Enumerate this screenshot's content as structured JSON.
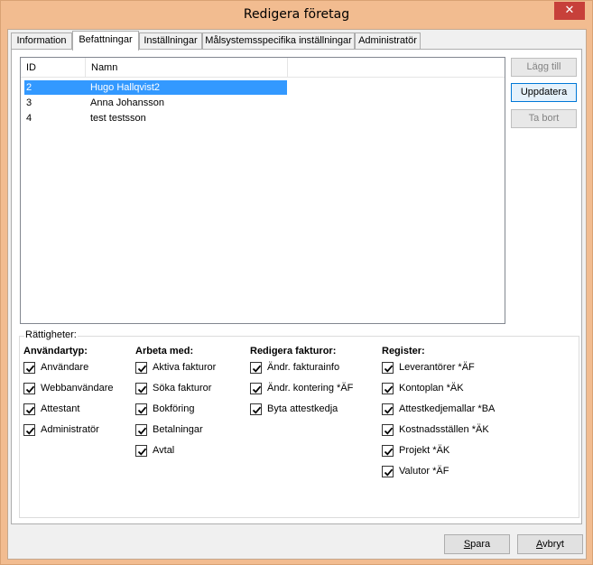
{
  "window": {
    "title": "Redigera företag",
    "close_glyph": "✕"
  },
  "tabs": [
    {
      "label": "Information"
    },
    {
      "label": "Befattningar"
    },
    {
      "label": "Inställningar"
    },
    {
      "label": "Målsystemsspecifika inställningar"
    },
    {
      "label": "Administratör"
    }
  ],
  "active_tab": "Befattningar",
  "list": {
    "columns": [
      "ID",
      "Namn"
    ],
    "rows": [
      {
        "id": "2",
        "name": "Hugo Hallqvist2",
        "selected": true
      },
      {
        "id": "3",
        "name": "Anna Johansson",
        "selected": false
      },
      {
        "id": "4",
        "name": "test testsson",
        "selected": false
      }
    ]
  },
  "side_buttons": {
    "add": "Lägg till",
    "update": "Uppdatera",
    "remove": "Ta bort"
  },
  "rights": {
    "title": "Rättigheter:",
    "groups": [
      {
        "heading": "Användartyp:",
        "items": [
          {
            "label": "Användare",
            "checked": true
          },
          {
            "label": "Webbanvändare",
            "checked": true
          },
          {
            "label": "Attestant",
            "checked": true
          },
          {
            "label": "Administratör",
            "checked": true
          }
        ]
      },
      {
        "heading": "Arbeta med:",
        "items": [
          {
            "label": "Aktiva fakturor",
            "checked": true
          },
          {
            "label": "Söka fakturor",
            "checked": true
          },
          {
            "label": "Bokföring",
            "checked": true
          },
          {
            "label": "Betalningar",
            "checked": true
          },
          {
            "label": "Avtal",
            "checked": true
          }
        ]
      },
      {
        "heading": "Redigera fakturor:",
        "items": [
          {
            "label": "Ändr. fakturainfo",
            "checked": true
          },
          {
            "label": "Ändr. kontering *ÄF",
            "checked": true
          },
          {
            "label": "Byta attestkedja",
            "checked": true
          }
        ]
      },
      {
        "heading": "Register:",
        "items": [
          {
            "label": "Leverantörer *ÄF",
            "checked": true
          },
          {
            "label": "Kontoplan *ÄK",
            "checked": true
          },
          {
            "label": "Attestkedjemallar *BA",
            "checked": true
          },
          {
            "label": "Kostnadsställen *ÄK",
            "checked": true
          },
          {
            "label": "Projekt *ÄK",
            "checked": true
          },
          {
            "label": "Valutor *ÄF",
            "checked": true
          }
        ]
      }
    ]
  },
  "footer": {
    "save": {
      "mnemonic": "S",
      "rest": "para"
    },
    "cancel": {
      "mnemonic": "A",
      "rest": "vbryt"
    }
  }
}
